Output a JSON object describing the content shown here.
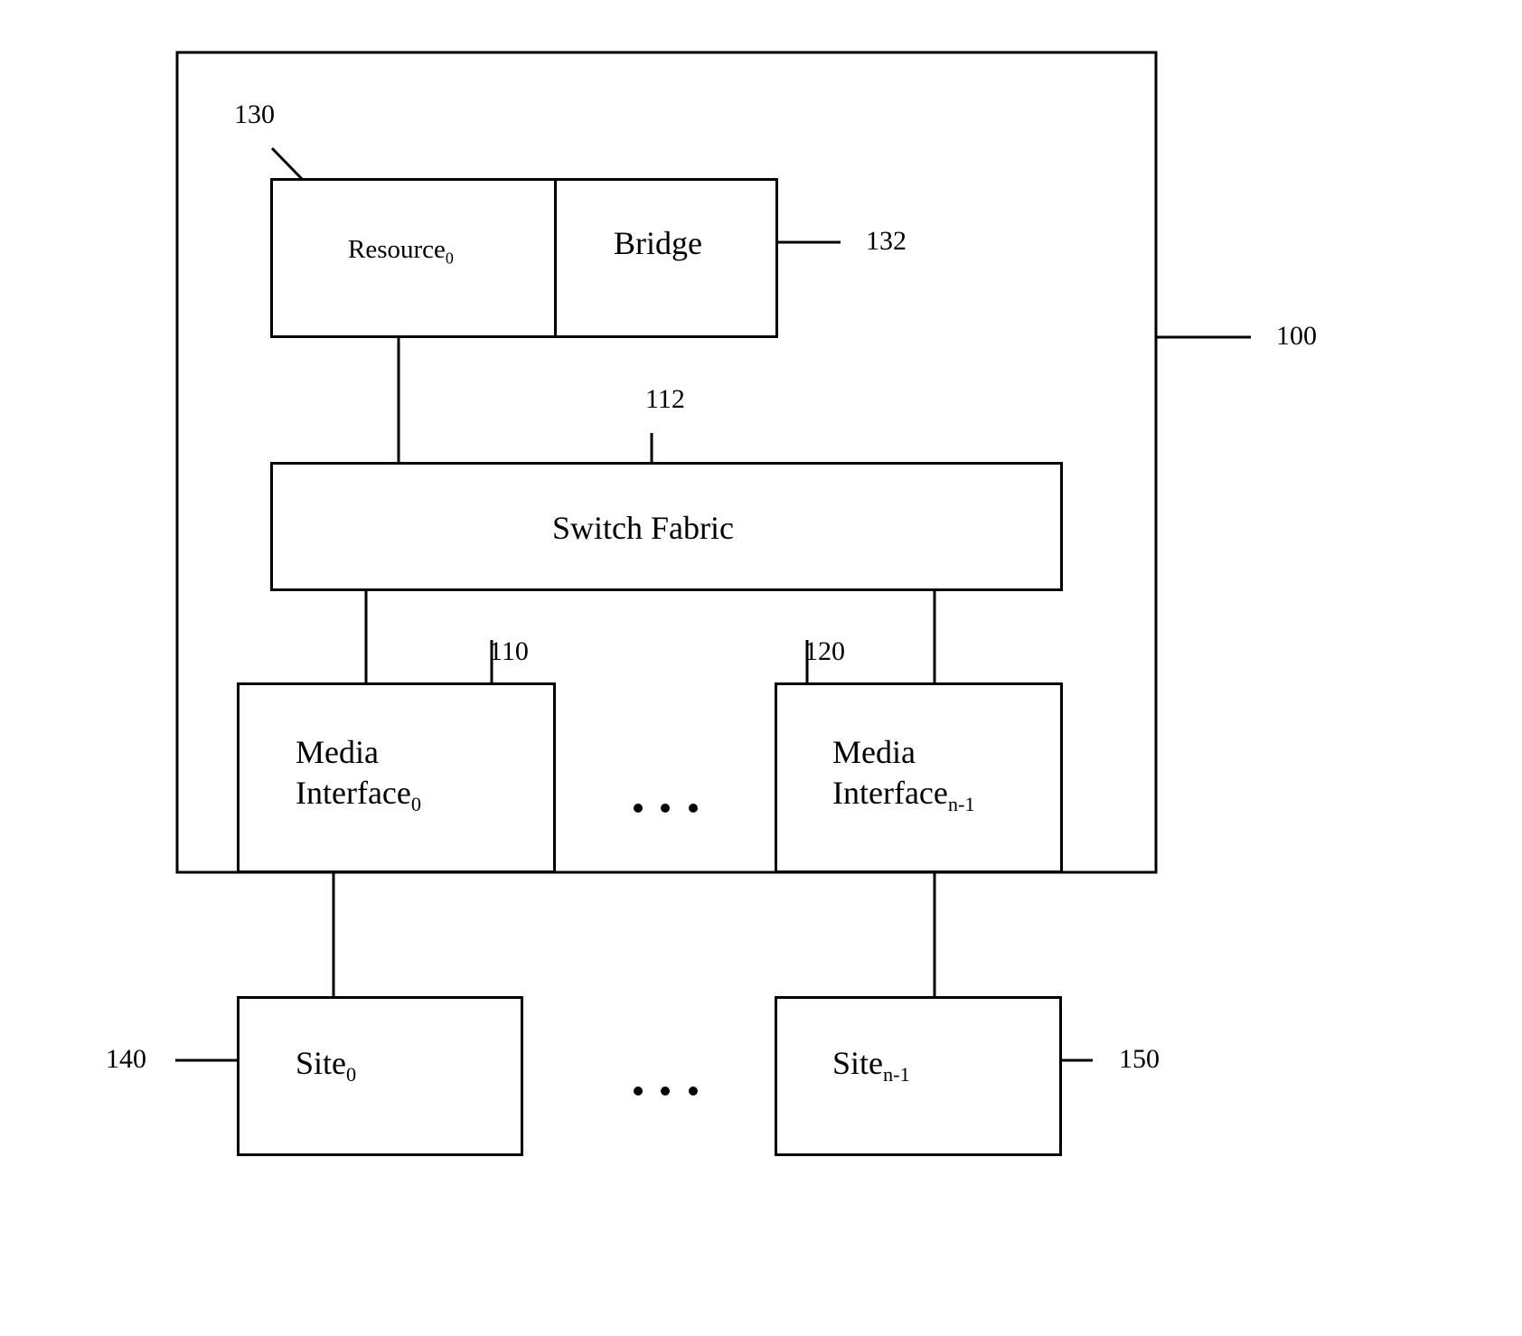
{
  "diagram": {
    "colors": {
      "stroke": "#000000",
      "background": "#ffffff"
    },
    "system": {
      "ref": "100"
    },
    "resource": {
      "label": "Resource",
      "subscript": "0",
      "ref": "130"
    },
    "bridge": {
      "label": "Bridge",
      "ref": "132"
    },
    "switch_fabric": {
      "label": "Switch Fabric",
      "ref": "112"
    },
    "media_interface_first": {
      "line1": "Media",
      "line2": "Interface",
      "subscript": "0",
      "ref": "110"
    },
    "media_interface_last": {
      "line1": "Media",
      "line2": "Interface",
      "subscript": "n-1",
      "ref": "120"
    },
    "site_first": {
      "label": "Site",
      "subscript": "0",
      "ref": "140"
    },
    "site_last": {
      "label": "Site",
      "subscript": "n-1",
      "ref": "150"
    },
    "ellipsis": "..."
  }
}
